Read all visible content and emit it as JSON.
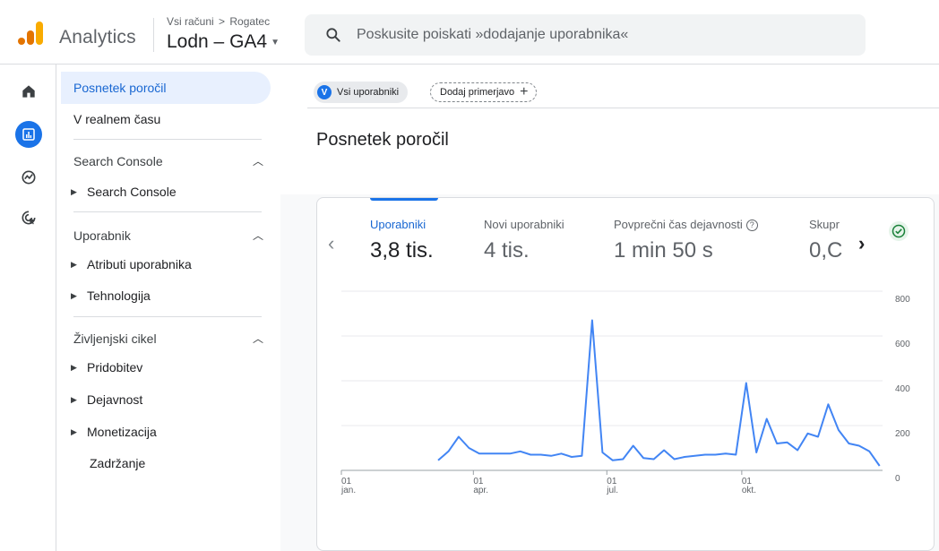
{
  "topbar": {
    "app_name": "Analytics",
    "breadcrumb_account": "Vsi računi",
    "breadcrumb_sep": ">",
    "breadcrumb_sub": "Rogatec",
    "property_name": "Lodn – GA4",
    "search_placeholder": "Poskusite poiskati »dodajanje uporabnika«"
  },
  "sidenav": {
    "items": [
      {
        "label": "Posnetek poročil"
      },
      {
        "label": "V realnem času"
      }
    ],
    "sections": [
      {
        "title": "Search Console",
        "children": [
          "Search Console"
        ]
      },
      {
        "title": "Uporabnik",
        "children": [
          "Atributi uporabnika",
          "Tehnologija"
        ]
      },
      {
        "title": "Življenjski cikel",
        "children": [
          "Pridobitev",
          "Dejavnost",
          "Monetizacija",
          "Zadržanje"
        ]
      }
    ]
  },
  "main": {
    "chip_all_badge": "V",
    "chip_all_label": "Vsi uporabniki",
    "chip_add_label": "Dodaj primerjavo",
    "page_title": "Posnetek poročil",
    "metrics": [
      {
        "label": "Uporabniki",
        "value": "3,8 tis."
      },
      {
        "label": "Novi uporabniki",
        "value": "4 tis."
      },
      {
        "label": "Povprečni čas dejavnosti",
        "value": "1 min 50 s"
      },
      {
        "label": "Skupr",
        "value": "0,C"
      }
    ]
  },
  "colors": {
    "accent": "#1a73e8",
    "line": "#4285f4",
    "check": "#188038"
  },
  "chart_data": {
    "type": "line",
    "series": [
      {
        "values": [
          [
            "2023-03-08",
            45
          ],
          [
            "2023-03-15",
            85
          ],
          [
            "2023-03-22",
            150
          ],
          [
            "2023-03-29",
            100
          ],
          [
            "2023-04-05",
            75
          ],
          [
            "2023-04-12",
            75
          ],
          [
            "2023-04-19",
            75
          ],
          [
            "2023-04-26",
            75
          ],
          [
            "2023-05-03",
            85
          ],
          [
            "2023-05-10",
            70
          ],
          [
            "2023-05-17",
            70
          ],
          [
            "2023-05-24",
            65
          ],
          [
            "2023-05-31",
            75
          ],
          [
            "2023-06-07",
            60
          ],
          [
            "2023-06-14",
            65
          ],
          [
            "2023-06-21",
            670
          ],
          [
            "2023-06-28",
            80
          ],
          [
            "2023-07-05",
            45
          ],
          [
            "2023-07-12",
            50
          ],
          [
            "2023-07-19",
            110
          ],
          [
            "2023-07-26",
            55
          ],
          [
            "2023-08-02",
            50
          ],
          [
            "2023-08-09",
            90
          ],
          [
            "2023-08-16",
            50
          ],
          [
            "2023-08-23",
            60
          ],
          [
            "2023-08-30",
            65
          ],
          [
            "2023-09-06",
            70
          ],
          [
            "2023-09-13",
            70
          ],
          [
            "2023-09-20",
            75
          ],
          [
            "2023-09-27",
            70
          ],
          [
            "2023-10-04",
            390
          ],
          [
            "2023-10-11",
            80
          ],
          [
            "2023-10-18",
            230
          ],
          [
            "2023-10-25",
            120
          ],
          [
            "2023-11-01",
            125
          ],
          [
            "2023-11-08",
            90
          ],
          [
            "2023-11-15",
            165
          ],
          [
            "2023-11-22",
            150
          ],
          [
            "2023-11-29",
            295
          ],
          [
            "2023-12-06",
            180
          ],
          [
            "2023-12-13",
            120
          ],
          [
            "2023-12-20",
            110
          ],
          [
            "2023-12-27",
            85
          ],
          [
            "2024-01-03",
            20
          ]
        ]
      }
    ],
    "x_ticks": [
      {
        "date": "2023-01-01",
        "day": "01",
        "month": "jan."
      },
      {
        "date": "2023-04-01",
        "day": "01",
        "month": "apr."
      },
      {
        "date": "2023-07-01",
        "day": "01",
        "month": "jul."
      },
      {
        "date": "2023-10-01",
        "day": "01",
        "month": "okt."
      }
    ],
    "y_ticks": [
      "0",
      "200",
      "400",
      "600",
      "800"
    ],
    "ylim": [
      0,
      800
    ],
    "xlim": [
      "2023-01-01",
      "2024-01-05"
    ],
    "y_axis_side": "right",
    "grid": true
  }
}
